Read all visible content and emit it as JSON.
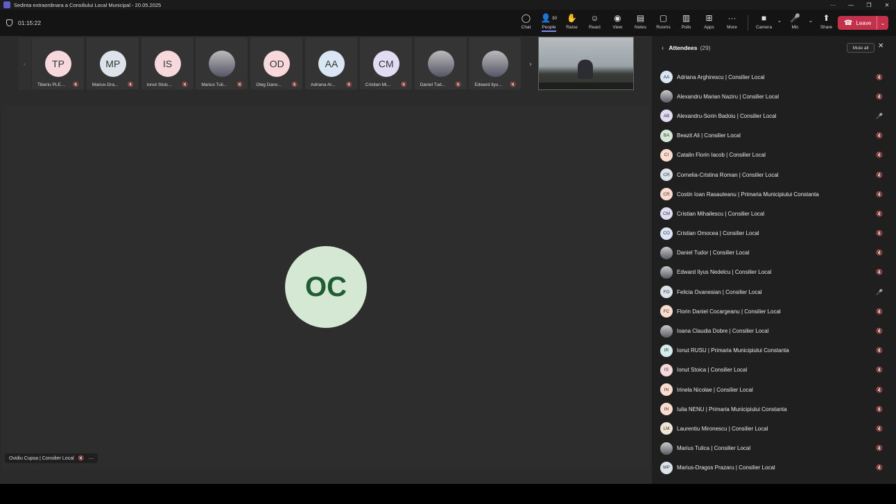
{
  "window": {
    "title": "Sedinta extraordinara a Consiliului Local Municipal - 20.05.2025",
    "controls": [
      "···",
      "—",
      "❐",
      "✕"
    ]
  },
  "toolbar": {
    "timer": "01:15:22",
    "tools": [
      {
        "id": "chat",
        "label": "Chat",
        "icon": "chat-icon",
        "glyph": "◯"
      },
      {
        "id": "people",
        "label": "People",
        "icon": "people-icon",
        "glyph": "👤",
        "badge": "30",
        "active": true
      },
      {
        "id": "raise",
        "label": "Raise",
        "icon": "hand-icon",
        "glyph": "✋"
      },
      {
        "id": "react",
        "label": "React",
        "icon": "smiley-icon",
        "glyph": "☺"
      },
      {
        "id": "view",
        "label": "View",
        "icon": "view-icon",
        "glyph": "◉"
      },
      {
        "id": "notes",
        "label": "Notes",
        "icon": "notes-icon",
        "glyph": "▤"
      },
      {
        "id": "rooms",
        "label": "Rooms",
        "icon": "rooms-icon",
        "glyph": "▢"
      },
      {
        "id": "polls",
        "label": "Polls",
        "icon": "polls-icon",
        "glyph": "▥"
      },
      {
        "id": "apps",
        "label": "Apps",
        "icon": "apps-icon",
        "glyph": "⊞"
      },
      {
        "id": "more",
        "label": "More",
        "icon": "more-icon",
        "glyph": "···"
      }
    ],
    "camera": {
      "label": "Camera",
      "glyph": "■"
    },
    "mic": {
      "label": "Mic",
      "glyph": "🎤"
    },
    "share": {
      "label": "Share",
      "glyph": "⬆"
    },
    "leave": {
      "label": "Leave",
      "glyph": "☎",
      "color": "#c4314b"
    }
  },
  "strip": {
    "prev_glyph": "‹",
    "next_glyph": "›",
    "tiles": [
      {
        "initials": "TP",
        "name": "Tiberiu PLE...",
        "color": "#f6d8dd",
        "photo": false
      },
      {
        "initials": "MP",
        "name": "Marius-Dra...",
        "color": "#dde3ea",
        "photo": false
      },
      {
        "initials": "IS",
        "name": "Ionut Stoic...",
        "color": "#f6d8dd",
        "photo": false
      },
      {
        "initials": "",
        "name": "Marius Tuli...",
        "color": "",
        "photo": true
      },
      {
        "initials": "OD",
        "name": "Oleg Dano...",
        "color": "#f6d8dd",
        "photo": false
      },
      {
        "initials": "AA",
        "name": "Adriana Ar...",
        "color": "#dbe6f5",
        "photo": false
      },
      {
        "initials": "CM",
        "name": "Cristian Mi...",
        "color": "#e2dcf2",
        "photo": false
      },
      {
        "initials": "",
        "name": "Daniel Tud...",
        "color": "",
        "photo": true
      },
      {
        "initials": "",
        "name": "Edward Ilyu...",
        "color": "",
        "photo": true
      }
    ]
  },
  "main": {
    "speaker_initials": "OC",
    "speaker_color": "#d5e8d4",
    "speaker_label": "Ovidiu Cupsa | Consilier Local"
  },
  "attendees": {
    "title": "Attendees",
    "count": "(29)",
    "mute_all": "Mute all",
    "list": [
      {
        "initials": "AA",
        "name": "Adriana Arghirescu | Consilier Local",
        "color": "#dbe6f5",
        "mic_on": false
      },
      {
        "initials": "",
        "name": "Alexandru Marian Naziru | Consilier Local",
        "photo": true,
        "mic_on": false
      },
      {
        "initials": "AB",
        "name": "Alexandru-Sorin Badoiu | Consilier Local",
        "color": "#e2dcf2",
        "mic_on": true
      },
      {
        "initials": "BA",
        "name": "Beazit Ali | Consilier Local",
        "color": "#d5e8d4",
        "mic_on": false
      },
      {
        "initials": "CI",
        "name": "Catalin Florin Iacob | Consilier Local",
        "color": "#fbdccf",
        "mic_on": false
      },
      {
        "initials": "CR",
        "name": "Cornelia-Cristina Roman | Consilier Local",
        "color": "#dde3ea",
        "mic_on": false
      },
      {
        "initials": "CR",
        "name": "Costin Ioan Rasauteanu | Primaria Municipiului Constanta",
        "color": "#fbdccf",
        "mic_on": false
      },
      {
        "initials": "CM",
        "name": "Cristian Mihailescu | Consilier Local",
        "color": "#e2dcf2",
        "mic_on": false
      },
      {
        "initials": "CO",
        "name": "Cristian Omocea | Consilier Local",
        "color": "#dbe6f5",
        "mic_on": false
      },
      {
        "initials": "",
        "name": "Daniel Tudor | Consilier Local",
        "photo": true,
        "mic_on": false
      },
      {
        "initials": "",
        "name": "Edward Ilyus Nedelcu | Consilier Local",
        "photo": true,
        "mic_on": false
      },
      {
        "initials": "FO",
        "name": "Felicia Ovanesian | Consilier Local",
        "color": "#dde3ea",
        "mic_on": true
      },
      {
        "initials": "FC",
        "name": "Florin Daniel Cocargeanu | Consilier Local",
        "color": "#fbdccf",
        "mic_on": false
      },
      {
        "initials": "",
        "name": "Ioana Claudia Dobre | Consilier Local",
        "photo": true,
        "mic_on": false
      },
      {
        "initials": "IR",
        "name": "Ionut RUSU | Primaria Municipiului Constanta",
        "color": "#d5ecec",
        "mic_on": false
      },
      {
        "initials": "IS",
        "name": "Ionut Stoica | Consilier Local",
        "color": "#f6d8dd",
        "mic_on": false
      },
      {
        "initials": "IN",
        "name": "Irinela Nicolae | Consilier Local",
        "color": "#fbdccf",
        "mic_on": false
      },
      {
        "initials": "IN",
        "name": "Iulia NENU | Primaria Municipiului Constanta",
        "color": "#fbdccf",
        "mic_on": false
      },
      {
        "initials": "LM",
        "name": "Laurentiu Mironescu | Consilier Local",
        "color": "#f0e4d4",
        "mic_on": false
      },
      {
        "initials": "",
        "name": "Marius Tulica | Consilier Local",
        "photo": true,
        "mic_on": false
      },
      {
        "initials": "MP",
        "name": "Marius-Dragos Prazaru | Consilier Local",
        "color": "#dde3ea",
        "mic_on": false
      }
    ]
  }
}
